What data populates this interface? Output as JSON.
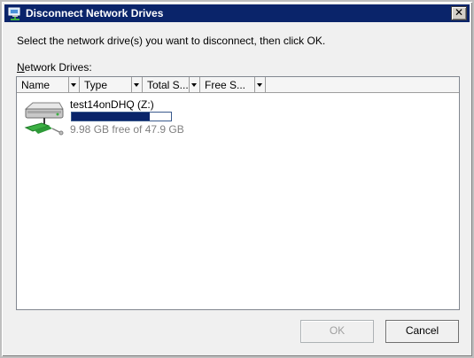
{
  "window": {
    "title": "Disconnect Network Drives",
    "close_label": "✕"
  },
  "instruction": "Select the network drive(s) you want to disconnect, then click OK.",
  "list": {
    "label_mnemonic": "N",
    "label_rest": "etwork Drives:",
    "columns": [
      {
        "label": "Name"
      },
      {
        "label": "Type"
      },
      {
        "label": "Total S..."
      },
      {
        "label": "Free S..."
      }
    ],
    "items": [
      {
        "name": "test14onDHQ (Z:)",
        "free_text": "9.98 GB free of 47.9 GB",
        "used_fraction": 0.79,
        "icon": "network-drive-icon"
      }
    ]
  },
  "buttons": {
    "ok": "OK",
    "cancel": "Cancel",
    "ok_enabled": false
  },
  "colors": {
    "title_bar": "#0a246a",
    "usage_bar": "#0a246a",
    "disabled_text": "#a0a0a0"
  }
}
